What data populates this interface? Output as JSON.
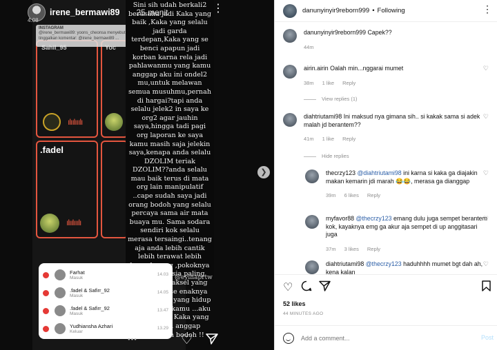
{
  "story": {
    "username": "irene_bermawi89",
    "time_ago": "25 menit",
    "sub_text": "4.08",
    "instagram_card": {
      "tag": "INSTAGRAM",
      "line1": "@irene_bermawi89: yoons_cheonsa menyebut",
      "line2": "tinggalkan komentar: @irene_bermawi89 ..."
    },
    "tile_label_top": "Sahil_95",
    "tile_label_top2": "Yoc",
    "tile_label": ".fadel",
    "text": "Sini sih udah berkali2 berusaha jadi Kaka yang baik ,Kaka yang selalu jadi garda terdepan,Kaka yang se benci apapun jadi korban karna rela jadi pahlawanmu yang kamu anggap aku ini ondel2 mu,untuk melawan semua musuhmu,pernah di hargai?tapi anda selalu jelek2 in saya ke org2 agar jauhin saya,hingga tadi pagi org laporan ke saya kamu masih saja jelekin saya,kenapa anda selalu DZOLIM teriak DZOLIM??anda selalu mau baik terus di mata org lain manipulatif ..cape sudah saya jadi orang bodoh yang selalu percaya sama air mata buaya mu. Sama sodara sendiri kok selalu merasa tersaingi..tenang aja anda lebih cantik lebih terawat lebih banyak uang ,pokoknya anda manusia paling kaya lah sejaksel yang bisa selalu se enaknya ngerendahin yang hidup nya di bawa kamu ...aku mundur jadi Kaka yang selalu kau anggap rendah dan bodoh !!",
    "mention": "@eylhaprtw",
    "calls": [
      {
        "name": "Farhat",
        "status": "Masuk",
        "time": "14.03"
      },
      {
        "name": ".fadel & Safirr_92",
        "status": "Masuk",
        "time": "14.05"
      },
      {
        "name": ".fadel & Safirr_92",
        "status": "Masuk",
        "time": "13.47"
      },
      {
        "name": "Yudhiansha Azhari",
        "status": "Keluar",
        "time": "13.29"
      }
    ]
  },
  "post": {
    "header": {
      "username": "danunyinyir9reborn999",
      "follow_status": "Following"
    },
    "caption": {
      "username": "danunyinyir9reborn999",
      "text": "Capek??",
      "time": "44m"
    },
    "comments": [
      {
        "username": "airin.airin",
        "text": "Oalah min...nggarai mumet",
        "time": "38m",
        "likes": "1 like",
        "reply": "Reply",
        "view_replies": "View replies (1)"
      },
      {
        "username": "diahtriutami98",
        "text": "Ini maksud nya gimana sih.. si kakak sama si adek malah jd berantem??",
        "time": "41m",
        "likes": "1 like",
        "reply": "Reply",
        "hide_replies": "Hide replies"
      }
    ],
    "replies": [
      {
        "username": "thecrzy123",
        "mention": "@diahtriutami98",
        "text": "ini karna si kaka ga diajakin makan kemarin jdi marah 😂😂, merasa ga dianggap",
        "time": "39m",
        "likes": "6 likes",
        "reply": "Reply"
      },
      {
        "username": "myfavor88",
        "mention": "@thecrzy123",
        "text": "emang dulu juga sempet berantem kok, kayaknya emg ga akur aja sempet di up anggitasari juga",
        "time": "37m",
        "likes": "3 likes",
        "reply": "Reply"
      },
      {
        "username": "diahtriutami98",
        "mention": "@thecrzy123",
        "text": "haduhhhh mumet bgt dah ah, kena kalan",
        "time": "",
        "likes": "",
        "reply": ""
      }
    ],
    "likes_count": "52 likes",
    "posted_ago": "44 MINUTES AGO",
    "add_comment_placeholder": "Add a comment...",
    "post_label": "Post"
  },
  "colors": {
    "accent": "#e5563f",
    "link": "#2b5ea7",
    "post_btn": "#b2dffc"
  }
}
